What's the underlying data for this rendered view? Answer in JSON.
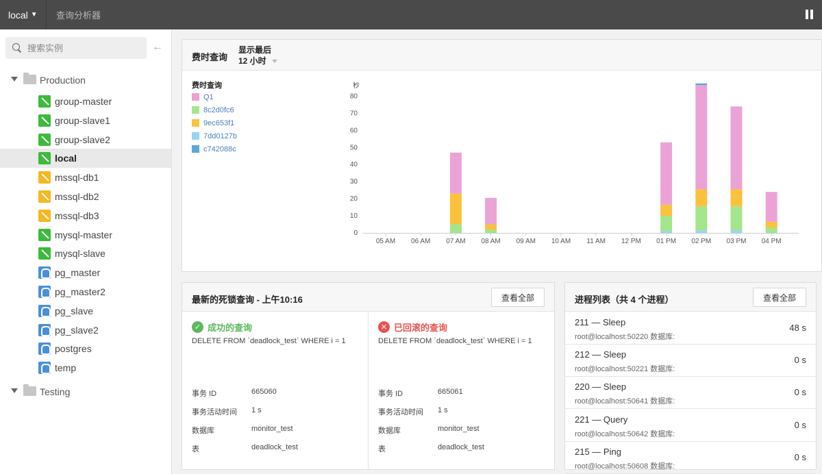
{
  "topbar": {
    "server": "local",
    "title": "查询分析器"
  },
  "sidebar": {
    "search_placeholder": "搜索实例",
    "groups": [
      {
        "label": "Production"
      },
      {
        "label": "Testing"
      }
    ],
    "instances": [
      {
        "name": "group-master",
        "type": "mysql"
      },
      {
        "name": "group-slave1",
        "type": "mysql"
      },
      {
        "name": "group-slave2",
        "type": "mysql"
      },
      {
        "name": "local",
        "type": "mysql",
        "selected": true
      },
      {
        "name": "mssql-db1",
        "type": "mssql"
      },
      {
        "name": "mssql-db2",
        "type": "mssql"
      },
      {
        "name": "mssql-db3",
        "type": "mssql"
      },
      {
        "name": "mysql-master",
        "type": "mysql"
      },
      {
        "name": "mysql-slave",
        "type": "mysql"
      },
      {
        "name": "pg_master",
        "type": "pg"
      },
      {
        "name": "pg_master2",
        "type": "pg"
      },
      {
        "name": "pg_slave",
        "type": "pg"
      },
      {
        "name": "pg_slave2",
        "type": "pg"
      },
      {
        "name": "postgres",
        "type": "pg"
      },
      {
        "name": "temp",
        "type": "pg"
      }
    ]
  },
  "chart_panel": {
    "title": "费时查询",
    "range_label": "显示最后",
    "range_value": "12 小时",
    "legend_title": "费时查询"
  },
  "chart_data": {
    "type": "bar",
    "stacked": true,
    "ylabel": "秒",
    "ylim": [
      0,
      85
    ],
    "yticks": [
      0,
      10,
      20,
      30,
      40,
      50,
      60,
      70,
      80
    ],
    "categories": [
      "05 AM",
      "06 AM",
      "07 AM",
      "08 AM",
      "09 AM",
      "10 AM",
      "11 AM",
      "12 PM",
      "01 PM",
      "02 PM",
      "03 PM",
      "04 PM"
    ],
    "series": [
      {
        "name": "c742088c",
        "color": "#5aa7d8",
        "values": [
          0,
          0,
          0,
          0,
          0,
          0,
          0,
          0,
          0,
          0,
          0,
          0
        ]
      },
      {
        "name": "7dd0127b",
        "color": "#99d4f2",
        "values": [
          0,
          0,
          0,
          0,
          0,
          0,
          0,
          0,
          1,
          1.5,
          1.5,
          0
        ]
      },
      {
        "name": "8c2d0fc6",
        "color": "#a3e68c",
        "values": [
          0,
          0,
          5,
          2,
          0,
          0,
          0,
          0,
          9,
          14,
          14,
          3
        ]
      },
      {
        "name": "9ec653f1",
        "color": "#fcc13d",
        "values": [
          0,
          0,
          18,
          3,
          0,
          0,
          0,
          0,
          6.5,
          10,
          10,
          3.5
        ]
      },
      {
        "name": "Q1",
        "color": "#eba3d6",
        "values": [
          0,
          0,
          24,
          15.5,
          0,
          0,
          0,
          0,
          36.5,
          61,
          48.5,
          17.5
        ]
      },
      {
        "name": "c742088c_top",
        "color": "#5aa7d8",
        "values": [
          0,
          0,
          0,
          0,
          0,
          0,
          0,
          0,
          0,
          1,
          0,
          0
        ]
      }
    ],
    "legend": [
      {
        "name": "Q1",
        "color": "#eba3d6"
      },
      {
        "name": "8c2d0fc6",
        "color": "#a3e68c"
      },
      {
        "name": "9ec653f1",
        "color": "#fcc13d"
      },
      {
        "name": "7dd0127b",
        "color": "#99d4f2"
      },
      {
        "name": "c742088c",
        "color": "#5aa7d8"
      }
    ]
  },
  "deadlock": {
    "title": "最新的死锁查询 - 上午10:16",
    "view_all": "查看全部",
    "success": {
      "label": "成功的查询",
      "sql": "DELETE FROM `deadlock_test` WHERE i = 1",
      "fields": [
        {
          "k": "事务 ID",
          "v": "665060"
        },
        {
          "k": "事务活动时间",
          "v": "1 s"
        },
        {
          "k": "数据库",
          "v": "monitor_test"
        },
        {
          "k": "表",
          "v": "deadlock_test"
        }
      ]
    },
    "rolledback": {
      "label": "已回滚的查询",
      "sql": "DELETE FROM `deadlock_test` WHERE i = 1",
      "fields": [
        {
          "k": "事务 ID",
          "v": "665061"
        },
        {
          "k": "事务活动时间",
          "v": "1 s"
        },
        {
          "k": "数据库",
          "v": "monitor_test"
        },
        {
          "k": "表",
          "v": "deadlock_test"
        }
      ]
    }
  },
  "processes": {
    "title": "进程列表（共 4 个进程）",
    "view_all": "查看全部",
    "items": [
      {
        "head": "211 — Sleep",
        "sub": "root@localhost:50220 数据库:",
        "dur": "48 s"
      },
      {
        "head": "212 — Sleep",
        "sub": "root@localhost:50221 数据库:",
        "dur": "0 s"
      },
      {
        "head": "220 — Sleep",
        "sub": "root@localhost:50641 数据库:",
        "dur": "0 s"
      },
      {
        "head": "221 — Query",
        "sub": "root@localhost:50642 数据库:",
        "dur": "0 s"
      },
      {
        "head": "215 — Ping",
        "sub": "root@localhost:50608 数据库:",
        "dur": "0 s"
      }
    ]
  }
}
